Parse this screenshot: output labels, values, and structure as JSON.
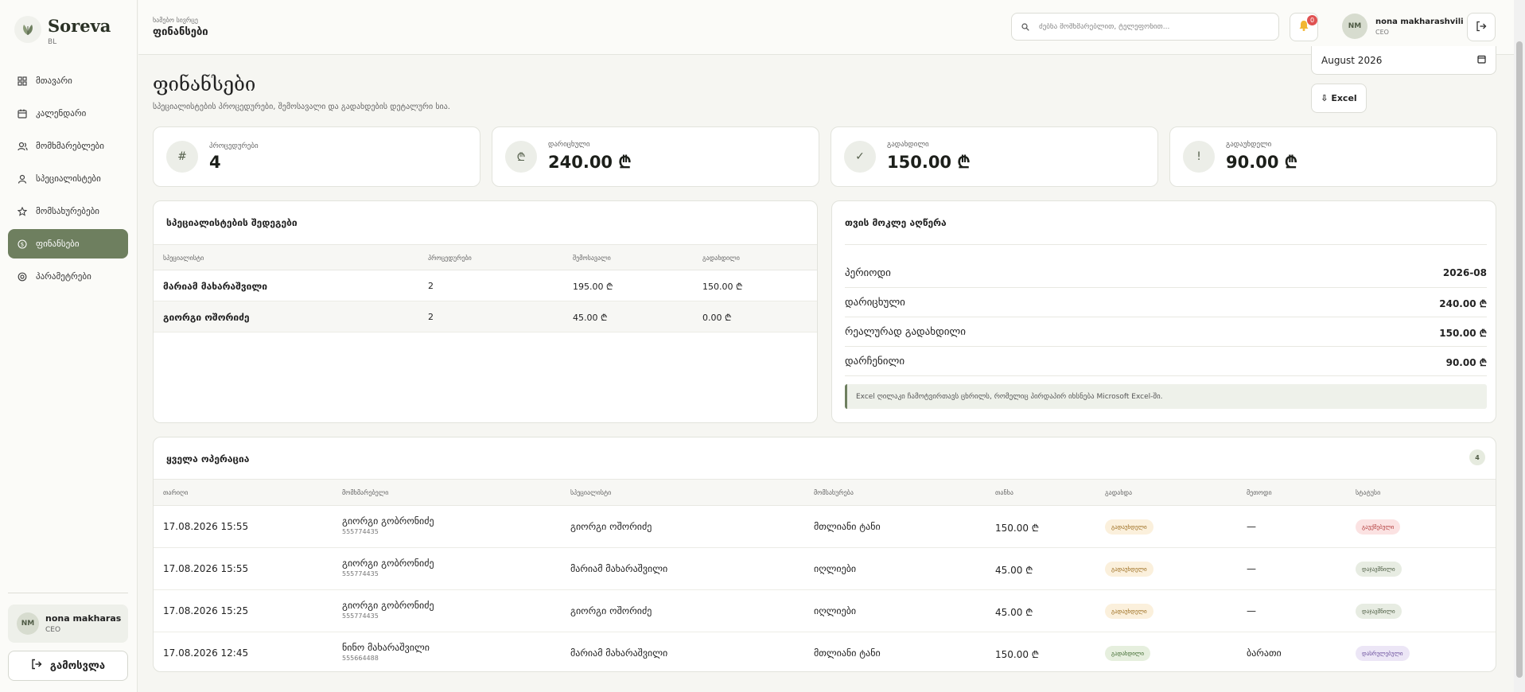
{
  "sidebar": {
    "brand_name": "Soreva",
    "brand_sub": "BL",
    "items": [
      {
        "label": "მთავარი",
        "icon": "grid-icon"
      },
      {
        "label": "კალენდარი",
        "icon": "calendar-icon"
      },
      {
        "label": "მომხმარებლები",
        "icon": "users-icon"
      },
      {
        "label": "სპეციალისტები",
        "icon": "user-icon"
      },
      {
        "label": "მომსახურებები",
        "icon": "star-icon"
      },
      {
        "label": "ფინანსები",
        "icon": "dollar-icon"
      },
      {
        "label": "პარამეტრები",
        "icon": "gear-icon"
      }
    ],
    "user_initials": "NM",
    "user_name": "nona makharas...",
    "user_role": "CEO",
    "logout_label": "გამოსვლა"
  },
  "topbar": {
    "crumb_small": "ხამებო სივრცე",
    "crumb_title": "ფინანსები",
    "search_placeholder": "ძებნა მომხმარებლით, ტელეფონით...",
    "notif_count": "0",
    "user_initials": "NM",
    "user_name": "nona makharashvili",
    "user_role": "CEO"
  },
  "page": {
    "title": "ფინანსები",
    "subtitle": "სპეციალისტების პროცედურები, შემოსავალი და გადახდების დეტალური სია.",
    "month_value": "August 2026",
    "excel_label": "⇩ Excel"
  },
  "stats": [
    {
      "label": "პროცედურები",
      "value": "4",
      "icon": "#"
    },
    {
      "label": "დარიცხული",
      "value": "240.00 ₾",
      "icon": "₾"
    },
    {
      "label": "გადახდილი",
      "value": "150.00 ₾",
      "icon": "✓"
    },
    {
      "label": "გადაუხდელი",
      "value": "90.00 ₾",
      "icon": "!"
    }
  ],
  "specialists": {
    "title": "სპეციალისტების შედეგები",
    "headers": [
      "სპეციალისტი",
      "პროცედურები",
      "შემოსავალი",
      "გადახდილი"
    ],
    "rows": [
      {
        "name": "მარიამ მახარაშვილი",
        "count": "2",
        "income": "195.00 ₾",
        "paid": "150.00 ₾"
      },
      {
        "name": "გიორგი ოშორიძე",
        "count": "2",
        "income": "45.00 ₾",
        "paid": "0.00 ₾"
      }
    ]
  },
  "summary": {
    "title": "თვის მოკლე აღწერა",
    "rows": [
      {
        "label": "პერიოდი",
        "value": "2026-08"
      },
      {
        "label": "დარიცხული",
        "value": "240.00 ₾"
      },
      {
        "label": "რეალურად გადახდილი",
        "value": "150.00 ₾"
      },
      {
        "label": "დარჩენილი",
        "value": "90.00 ₾"
      }
    ],
    "note": "Excel ღილაკი ჩამოტვირთავს ცხრილს, რომელიც პირდაპირ იხსნება Microsoft Excel-ში."
  },
  "operations": {
    "title": "ყველა ოპერაცია",
    "count": "4",
    "headers": [
      "თარიღი",
      "მომხმარებელი",
      "სპეციალისტი",
      "მომსახურება",
      "თანხა",
      "გადახდა",
      "მეთოდი",
      "სტატუსი"
    ],
    "rows": [
      {
        "date": "17.08.2026 15:55",
        "client": "გიორგი გობრონიძე",
        "phone": "555774435",
        "specialist": "გიორგი ოშორიძე",
        "service": "მთლიანი ტანი",
        "amount": "150.00 ₾",
        "payment": "გადაუხდელი",
        "method": "—",
        "status": "გაუქმებული"
      },
      {
        "date": "17.08.2026 15:55",
        "client": "გიორგი გობრონიძე",
        "phone": "555774435",
        "specialist": "მარიამ მახარაშვილი",
        "service": "იღლიები",
        "amount": "45.00 ₾",
        "payment": "გადაუხდელი",
        "method": "—",
        "status": "დაჯავშნილი"
      },
      {
        "date": "17.08.2026 15:25",
        "client": "გიორგი გობრონიძე",
        "phone": "555774435",
        "specialist": "გიორგი ოშორიძე",
        "service": "იღლიები",
        "amount": "45.00 ₾",
        "payment": "გადაუხდელი",
        "method": "—",
        "status": "დაჯავშნილი"
      },
      {
        "date": "17.08.2026 12:45",
        "client": "ნინო მახარაშვილი",
        "phone": "555664488",
        "specialist": "მარიამ მახარაშვილი",
        "service": "მთლიანი ტანი",
        "amount": "150.00 ₾",
        "payment": "გადახდილი",
        "method": "ბარათი",
        "status": "დასრულებული"
      }
    ]
  },
  "colors": {
    "accent": "#6e7f5f",
    "pill_unpaid_bg": "#fbf0dc",
    "pill_unpaid_fg": "#9a6a1a",
    "pill_paid_bg": "#e6efde",
    "pill_paid_fg": "#3f6a2f",
    "pill_cancel_bg": "#fbe2e2",
    "pill_cancel_fg": "#b23a3a",
    "pill_booked_bg": "#e7ece2",
    "pill_booked_fg": "#4a5a40",
    "pill_done_bg": "#ece6f6",
    "pill_done_fg": "#6a4f9c"
  }
}
